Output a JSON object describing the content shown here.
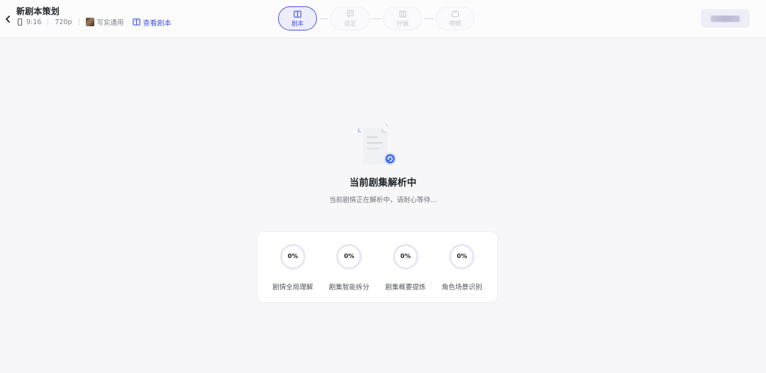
{
  "header": {
    "title": "新剧本策划",
    "aspect_ratio": "9:16",
    "resolution": "720p",
    "style": "写实通用",
    "view_script_label": "查看剧本",
    "user_name": "user"
  },
  "steps": [
    {
      "label": "剧本",
      "icon": "book-icon",
      "active": true
    },
    {
      "label": "设定",
      "icon": "settings-doc-icon",
      "active": false
    },
    {
      "label": "分镜",
      "icon": "storyboard-icon",
      "active": false
    },
    {
      "label": "视频",
      "icon": "video-icon",
      "active": false
    }
  ],
  "status": {
    "heading": "当前剧集解析中",
    "subtext": "当前剧情正在解析中，请耐心等待..."
  },
  "tasks": [
    {
      "label": "剧情全局理解",
      "progress": "0%"
    },
    {
      "label": "剧集智能拆分",
      "progress": "0%"
    },
    {
      "label": "剧集概要提炼",
      "progress": "0%"
    },
    {
      "label": "角色场景识别",
      "progress": "0%"
    }
  ],
  "colors": {
    "accent": "#4a54e1",
    "background": "#f7f7f9",
    "ring_track": "#e6e7f2"
  }
}
